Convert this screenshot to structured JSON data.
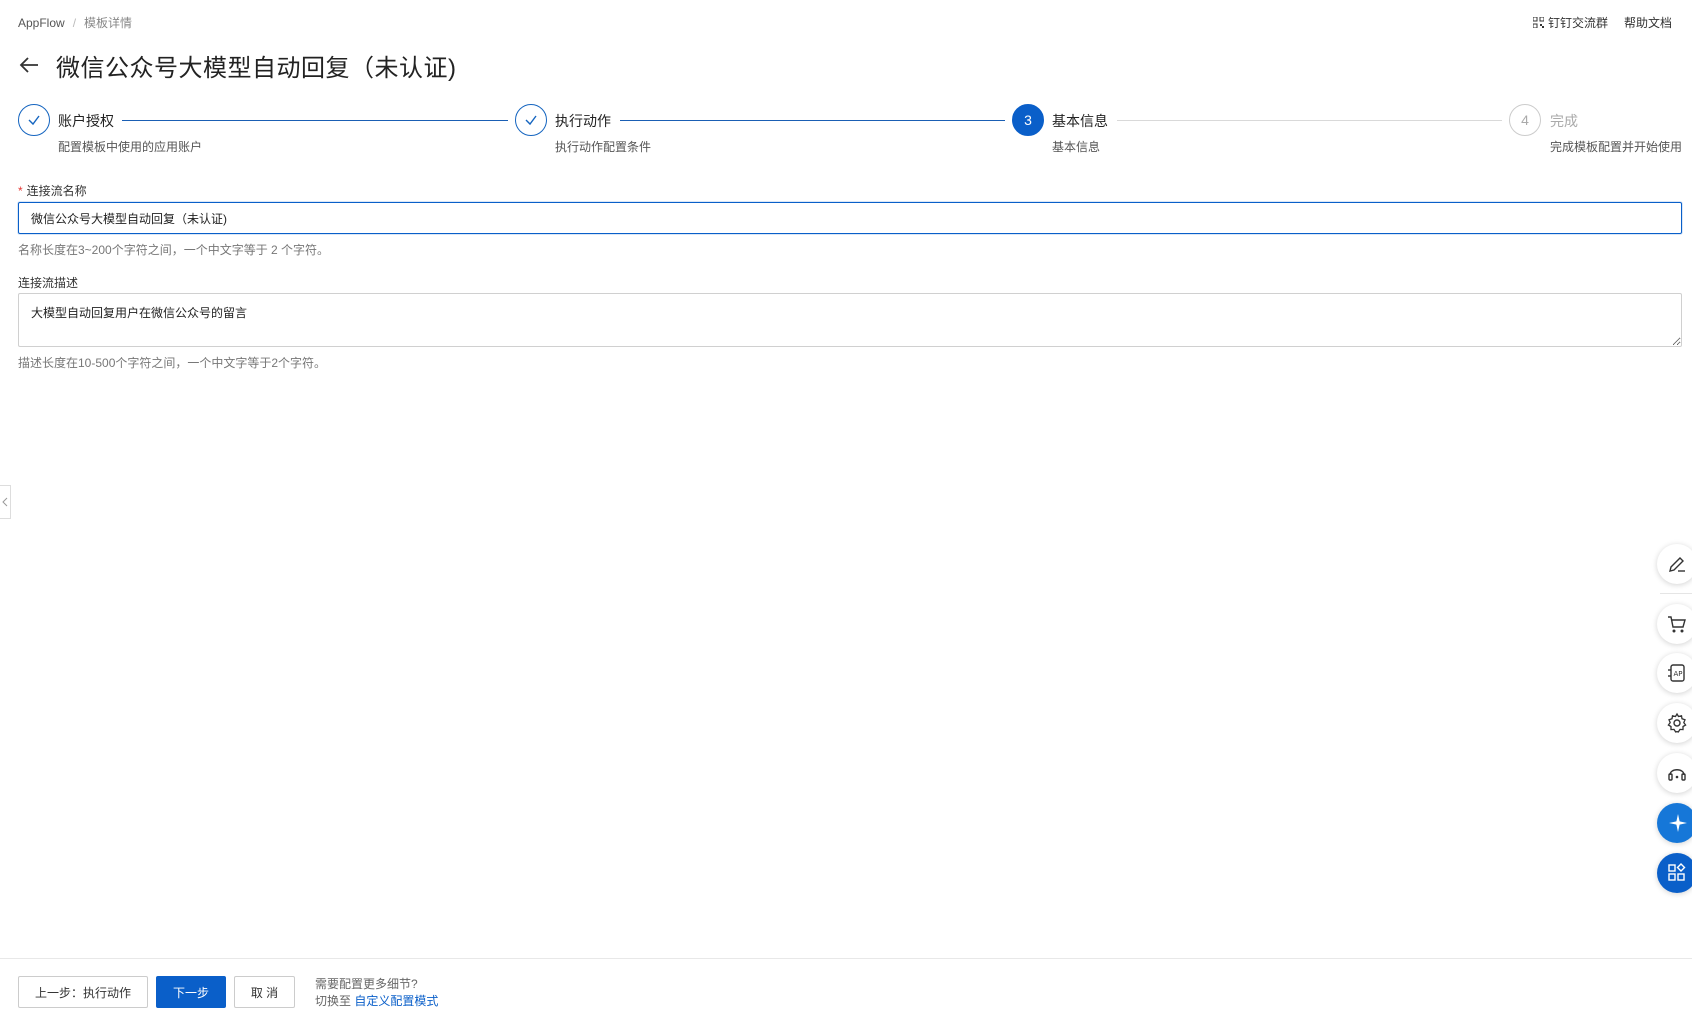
{
  "breadcrumb": {
    "root": "AppFlow",
    "separator": "/",
    "current": "模板详情"
  },
  "top_links": {
    "dingtalk_label": "钉钉交流群",
    "help_label": "帮助文档"
  },
  "page": {
    "title": "微信公众号大模型自动回复（未认证)"
  },
  "steps": [
    {
      "index": "1",
      "title": "账户授权",
      "desc": "配置模板中使用的应用账户",
      "status": "done"
    },
    {
      "index": "2",
      "title": "执行动作",
      "desc": "执行动作配置条件",
      "status": "done"
    },
    {
      "index": "3",
      "title": "基本信息",
      "desc": "基本信息",
      "status": "active"
    },
    {
      "index": "4",
      "title": "完成",
      "desc": "完成模板配置并开始使用",
      "status": "todo"
    }
  ],
  "form": {
    "name": {
      "required_mark": "*",
      "label": "连接流名称",
      "value": "微信公众号大模型自动回复（未认证)",
      "hint": "名称长度在3~200个字符之间，一个中文字等于 2 个字符。"
    },
    "description": {
      "label": "连接流描述",
      "value": "大模型自动回复用户在微信公众号的留言",
      "hint": "描述长度在10-500个字符之间，一个中文字等于2个字符。"
    }
  },
  "float_toolbar": {
    "icons": [
      "edit-icon",
      "cart-icon",
      "api-icon",
      "gear-icon",
      "headset-icon",
      "assistant-icon",
      "apps-icon"
    ]
  },
  "footer": {
    "prev_label": "上一步：执行动作",
    "next_label": "下一步",
    "cancel_label": "取 消",
    "note_line1": "需要配置更多细节?",
    "note_prefix": "切换至",
    "note_link": "自定义配置模式"
  },
  "colors": {
    "primary": "#0a5fc9",
    "step_line_done": "#1a5fb4",
    "required": "#e53935"
  }
}
